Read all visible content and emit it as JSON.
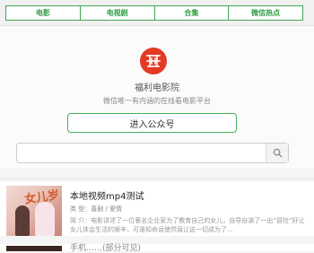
{
  "nav": {
    "tabs": [
      "电影",
      "电视剧",
      "合集",
      "微信热点"
    ]
  },
  "site": {
    "name": "福利电影院",
    "description": "微信唯一有内涵的在线看电影平台",
    "follow_label": "进入公众号",
    "accent_color": "#42a553",
    "logo_color": "#e33a24"
  },
  "search": {
    "placeholder": "",
    "value": ""
  },
  "movies": [
    {
      "poster_text": "女儿岁",
      "title": "本地视频mp4测试",
      "meta": "类 型：喜剧 / 爱情",
      "desc": "简 介：电影讲述了一位著名企业家为了教育自己的女儿，自导自演了一出“冒险”好让女儿体会生活的艰辛，可谁知命运使然竟让这一切成为了..."
    },
    {
      "title": "手机……(部分可见)"
    }
  ]
}
